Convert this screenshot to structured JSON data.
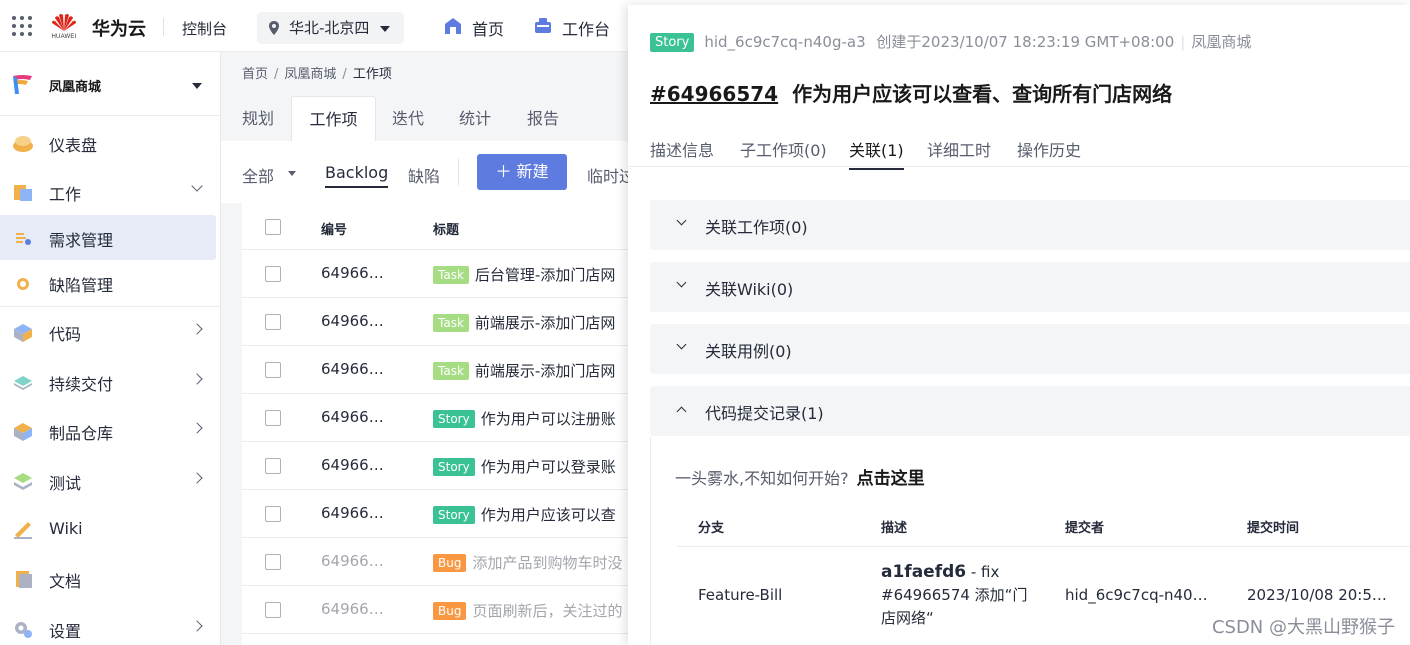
{
  "topbar": {
    "logo_text": "HUAWEI",
    "brand": "华为云",
    "console": "控制台",
    "region": "华北-北京四",
    "nav_home": "首页",
    "nav_workbench": "工作台"
  },
  "sidebar": {
    "project_name": "凤凰商城",
    "items": [
      {
        "label": "仪表盘",
        "icon": "dashboard-icon"
      },
      {
        "label": "工作",
        "icon": "work-icon"
      },
      {
        "label": "需求管理",
        "icon": "requirements-icon"
      },
      {
        "label": "缺陷管理",
        "icon": "bug-icon"
      },
      {
        "label": "代码",
        "icon": "code-icon"
      },
      {
        "label": "持续交付",
        "icon": "delivery-icon"
      },
      {
        "label": "制品仓库",
        "icon": "artifact-icon"
      },
      {
        "label": "测试",
        "icon": "test-icon"
      },
      {
        "label": "Wiki",
        "icon": "wiki-icon"
      },
      {
        "label": "文档",
        "icon": "docs-icon"
      },
      {
        "label": "设置",
        "icon": "settings-icon"
      }
    ]
  },
  "breadcrumb": {
    "home": "首页",
    "project": "凤凰商城",
    "current": "工作项"
  },
  "main_tabs": [
    "规划",
    "工作项",
    "迭代",
    "统计",
    "报告"
  ],
  "toolbar": {
    "all": "全部",
    "backlog": "Backlog",
    "defect": "缺陷",
    "new_button": "新建",
    "temp": "临时过"
  },
  "table": {
    "headers": {
      "number": "编号",
      "title": "标题"
    },
    "rows": [
      {
        "num": "64966…",
        "type": "Task",
        "title": "后台管理-添加门店网"
      },
      {
        "num": "64966…",
        "type": "Task",
        "title": "前端展示-添加门店网"
      },
      {
        "num": "64966…",
        "type": "Task",
        "title": "前端展示-添加门店网"
      },
      {
        "num": "64966…",
        "type": "Story",
        "title": "作为用户可以注册账"
      },
      {
        "num": "64966…",
        "type": "Story",
        "title": "作为用户可以登录账"
      },
      {
        "num": "64966…",
        "type": "Story",
        "title": "作为用户应该可以查"
      },
      {
        "num": "64966…",
        "type": "Bug",
        "title": "添加产品到购物车时没"
      },
      {
        "num": "64966…",
        "type": "Bug",
        "title": "页面刷新后，关注过的"
      }
    ]
  },
  "detail": {
    "type_badge": "Story",
    "creator": "hid_6c9c7cq-n40g-a3",
    "created_at": "创建于2023/10/07 18:23:19 GMT+08:00",
    "project": "凤凰商城",
    "id": "#64966574",
    "title": "作为用户应该可以查看、查询所有门店网络",
    "tabs": [
      "描述信息",
      "子工作项(0)",
      "关联(1)",
      "详细工时",
      "操作历史"
    ],
    "sections": [
      "关联工作项(0)",
      "关联Wiki(0)",
      "关联用例(0)",
      "代码提交记录(1)"
    ],
    "hint": "一头雾水,不知如何开始?",
    "hint_link": "点击这里",
    "commit_headers": {
      "branch": "分支",
      "desc": "描述",
      "author": "提交者",
      "time": "提交时间"
    },
    "commit": {
      "branch": "Feature-Bill",
      "sha": "a1faefd6",
      "desc_suffix": " - fix",
      "desc_line2": "#64966574 添加“门",
      "desc_line3": "店网络“",
      "author": "hid_6c9c7cq-n40…",
      "time": "2023/10/08 20:5…"
    }
  },
  "watermark": "CSDN @大黑山野猴子",
  "colors": {
    "primary": "#5e7ce0",
    "story": "#3ac295",
    "task": "#a6dd82",
    "bug": "#fa9841",
    "active_nav": "#e6ebf7"
  }
}
